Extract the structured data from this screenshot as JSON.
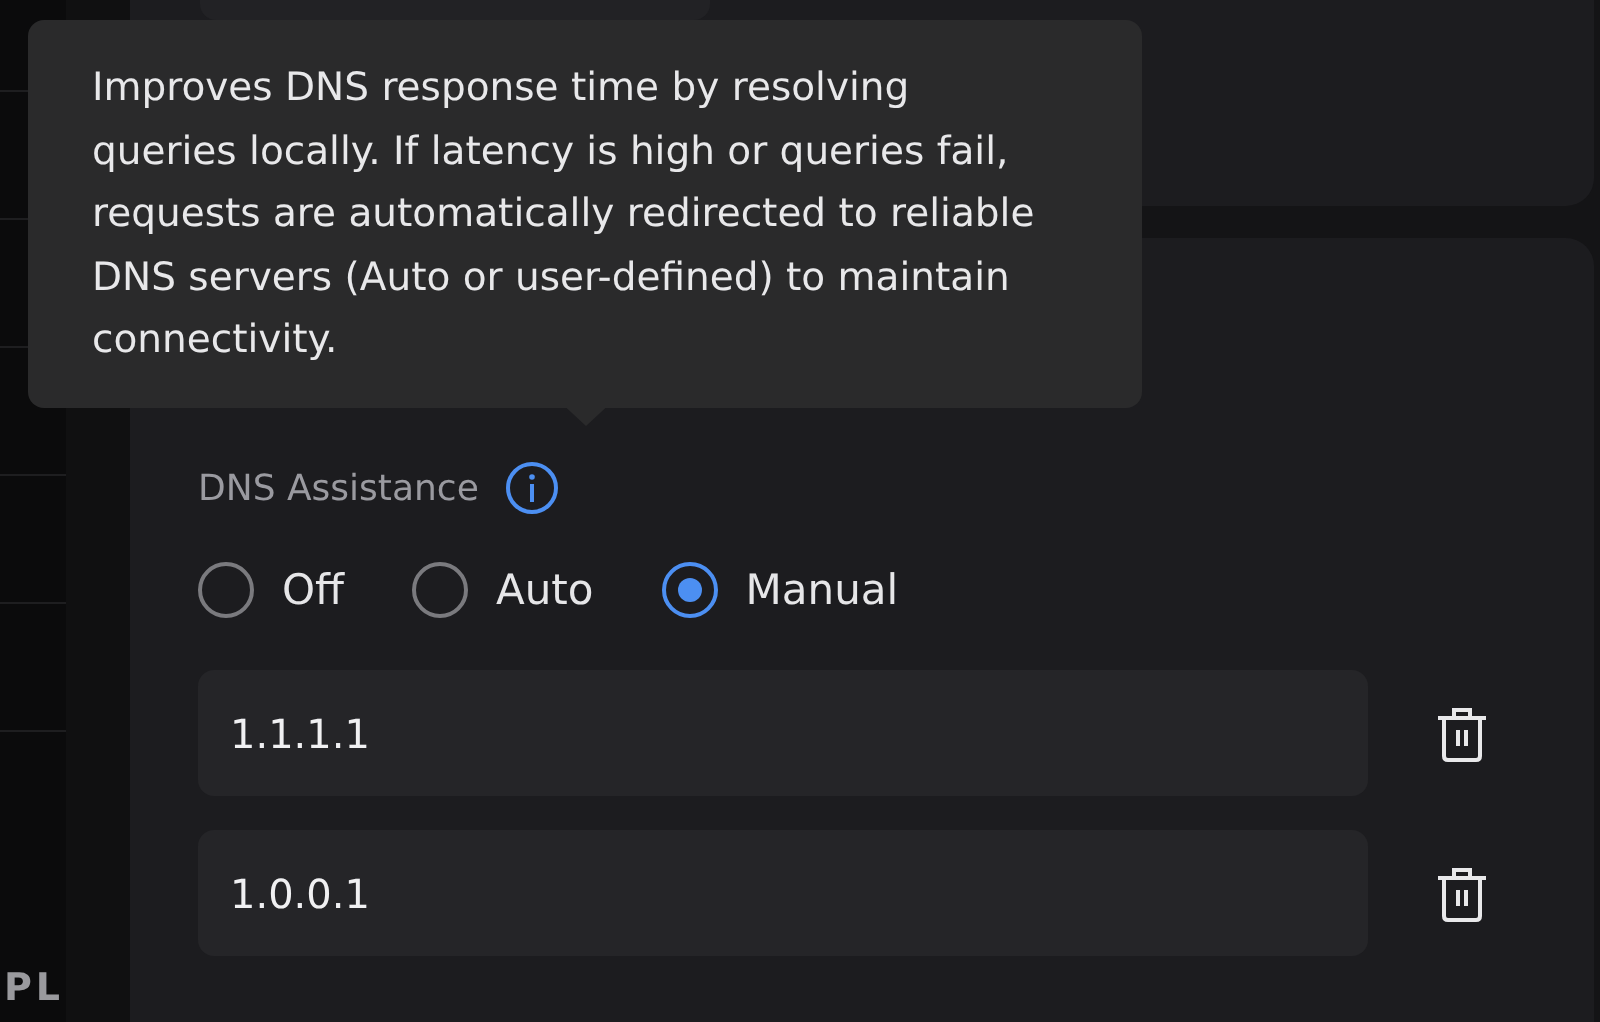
{
  "sidebar": {
    "footer_text": "PL"
  },
  "tooltip": {
    "text": "Improves DNS response time by resolving queries locally. If latency is high or queries fail, requests are automatically redirected to reliable DNS servers (Auto or user-defined) to maintain connectivity."
  },
  "dns_assistance": {
    "label": "DNS Assistance",
    "options": [
      {
        "label": "Off",
        "selected": false
      },
      {
        "label": "Auto",
        "selected": false
      },
      {
        "label": "Manual",
        "selected": true
      }
    ]
  },
  "servers": [
    {
      "value": "1.1.1.1"
    },
    {
      "value": "1.0.0.1"
    }
  ]
}
